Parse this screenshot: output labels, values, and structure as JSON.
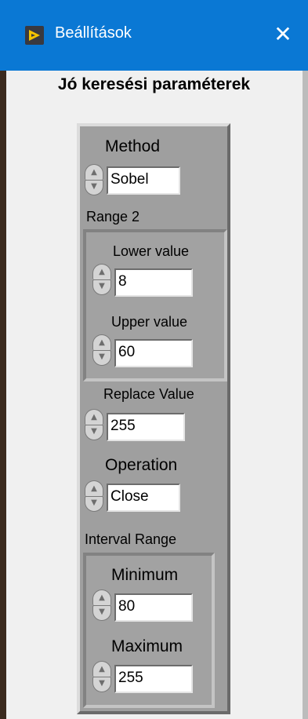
{
  "window": {
    "title": "Beállítások",
    "close_glyph": "✕",
    "icon": "labview-play-icon"
  },
  "heading": "Jó keresési paraméterek",
  "settings": {
    "method": {
      "label": "Method",
      "value": "Sobel"
    },
    "range2": {
      "label": "Range 2",
      "lower": {
        "label": "Lower value",
        "value": "8"
      },
      "upper": {
        "label": "Upper value",
        "value": "60"
      }
    },
    "replace_value": {
      "label": "Replace Value",
      "value": "255"
    },
    "operation": {
      "label": "Operation",
      "value": "Close"
    },
    "interval_range": {
      "label": "Interval Range",
      "minimum": {
        "label": "Minimum",
        "value": "80"
      },
      "maximum": {
        "label": "Maximum",
        "value": "255"
      }
    }
  },
  "spinner": {
    "up_glyph": "▲",
    "down_glyph": "▼"
  },
  "colors": {
    "titlebar": "#0a78d4",
    "panel": "#9f9f9f",
    "icon_accent": "#f5c400"
  }
}
